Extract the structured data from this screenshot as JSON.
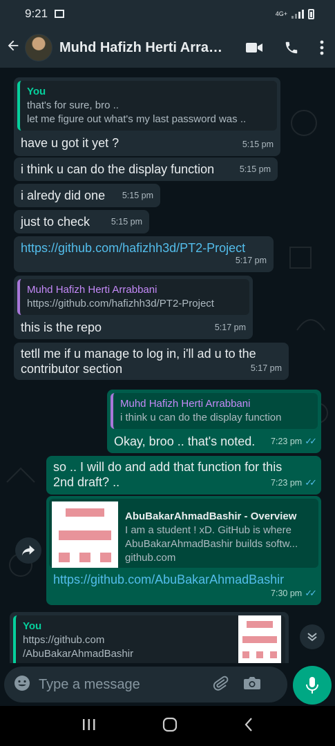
{
  "status_bar": {
    "time": "9:21",
    "network": "4G+"
  },
  "header": {
    "contact_name": "Muhd Hafizh Herti Arrabbani"
  },
  "messages": {
    "m1": {
      "quote_sender": "You",
      "quote_line1": "that's for sure, bro ..",
      "quote_line2": "let me figure out what's my last password was ..",
      "text": "have u got it yet ?",
      "time": "5:15 pm"
    },
    "m2": {
      "text": "i think u can do the display function",
      "time": "5:15 pm"
    },
    "m3": {
      "text": "i alredy did one",
      "time": "5:15 pm"
    },
    "m4": {
      "text": "just to check",
      "time": "5:15 pm"
    },
    "m5": {
      "text": "https://github.com/hafizhh3d/PT2-Project",
      "time": "5:17 pm"
    },
    "m6": {
      "quote_sender": "Muhd Hafizh Herti Arrabbani",
      "quote_text": "https://github.com/hafizhh3d/PT2-Project",
      "text": "this is the repo",
      "time": "5:17 pm"
    },
    "m7": {
      "line1": "tetll me if u manage to log in, i'll ad u to the",
      "line2": "contributor section",
      "time": "5:17 pm"
    },
    "m8": {
      "quote_sender": "Muhd Hafizh Herti Arrabbani",
      "quote_text": "i think u can do the display function",
      "text": "Okay, broo .. that's noted.",
      "time": "7:23 pm"
    },
    "m9": {
      "line1": "so .. I will do and add that function for this",
      "line2": "2nd draft? ..",
      "time": "7:23 pm"
    },
    "m10": {
      "preview_title": "AbuBakarAhmadBashir - Overview",
      "preview_line1": "I am a student ! xD. GitHub is where",
      "preview_line2": "AbuBakarAhmadBashir builds softw...",
      "preview_domain": "github.com",
      "text": "https://github.com/AbuBakarAhmadBashir",
      "time": "7:30 pm"
    },
    "m11": {
      "quote_sender": "You",
      "quote_line1": "https://github.com",
      "quote_line2": "/AbuBakarAhmadBashir"
    }
  },
  "input": {
    "placeholder": "Type a message"
  },
  "icons": {
    "back": "arrow-left-icon",
    "video": "video-call-icon",
    "call": "phone-icon",
    "menu": "more-vert-icon",
    "forward": "forward-icon",
    "scroll": "chevrons-down-icon",
    "emoji": "emoji-icon",
    "attach": "paperclip-icon",
    "camera": "camera-icon",
    "mic": "mic-icon"
  },
  "colors": {
    "incoming": "#1f2c34",
    "outgoing": "#005c4b",
    "accent": "#00a884",
    "link": "#53bdeb",
    "read_ticks": "#53bdeb"
  }
}
